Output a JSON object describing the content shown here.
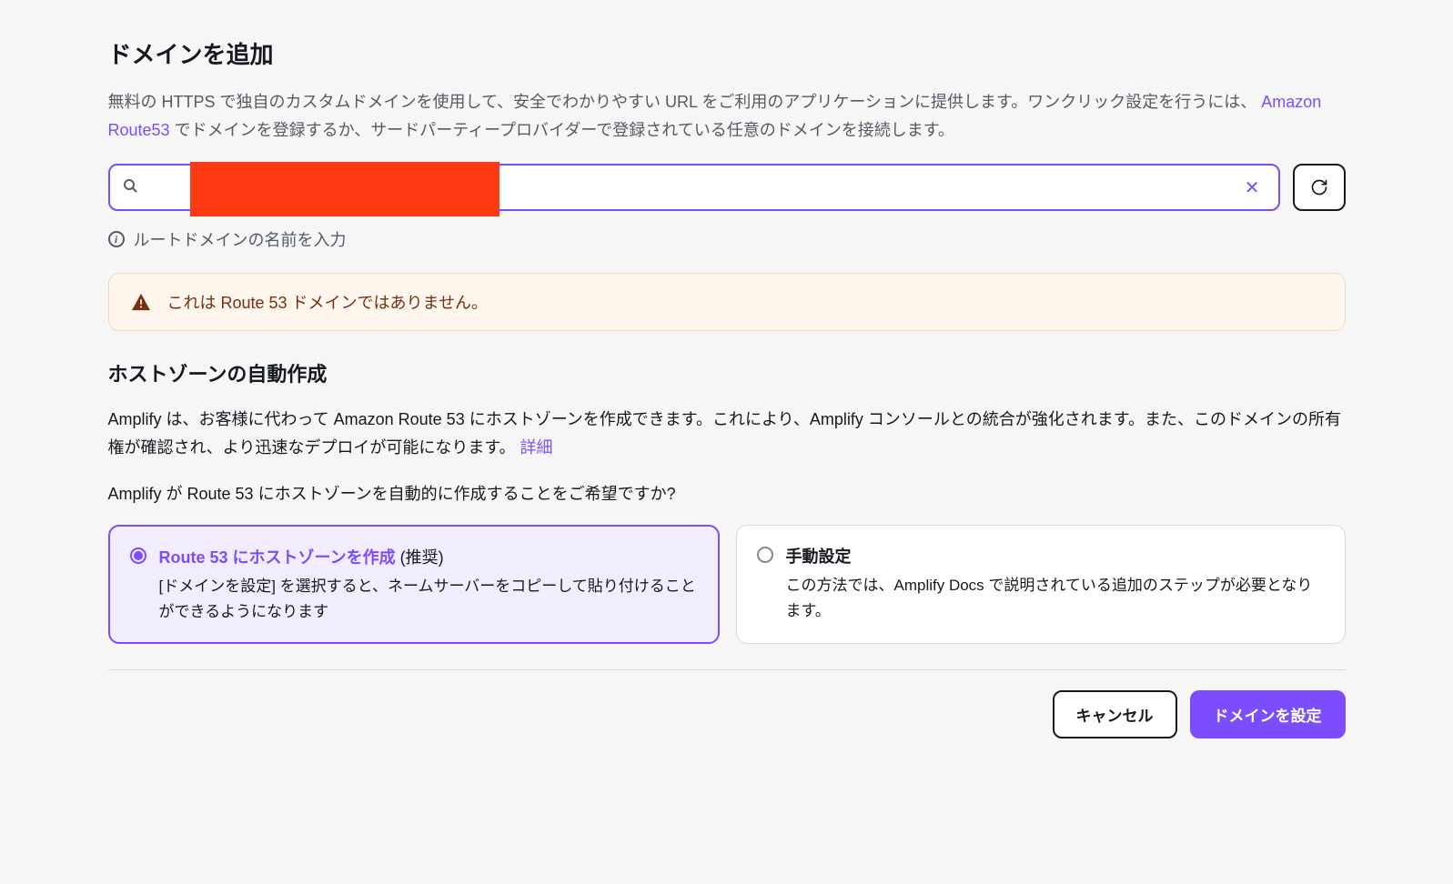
{
  "page": {
    "title": "ドメインを追加",
    "intro_prefix": "無料の HTTPS で独自のカスタムドメインを使用して、安全でわかりやすい URL をご利用のアプリケーションに提供します。ワンクリック設定を行うには、",
    "intro_link": "Amazon Route53",
    "intro_suffix": " でドメインを登録するか、サードパーティープロバイダーで登録されている任意のドメインを接続します。"
  },
  "search": {
    "value": "",
    "placeholder": "",
    "help_text": "ルートドメインの名前を入力"
  },
  "alert": {
    "message": "これは Route 53 ドメインではありません。"
  },
  "hosted_zone": {
    "title": "ホストゾーンの自動作成",
    "desc_prefix": "Amplify は、お客様に代わって Amazon Route 53 にホストゾーンを作成できます。これにより、Amplify コンソールとの統合が強化されます。また、このドメインの所有権が確認され、より迅速なデプロイが可能になります。 ",
    "desc_link": "詳細",
    "question": "Amplify が Route 53 にホストゾーンを自動的に作成することをご希望ですか?"
  },
  "options": [
    {
      "title_strong": "Route 53 にホストゾーンを作成",
      "title_suffix": "  (推奨)",
      "desc": "[ドメインを設定] を選択すると、ネームサーバーをコピーして貼り付けることができるようになります",
      "selected": true
    },
    {
      "title_strong": "手動設定",
      "title_suffix": "",
      "desc": "この方法では、Amplify Docs で説明されている追加のステップが必要となります。",
      "selected": false
    }
  ],
  "buttons": {
    "cancel": "キャンセル",
    "submit": "ドメインを設定"
  }
}
